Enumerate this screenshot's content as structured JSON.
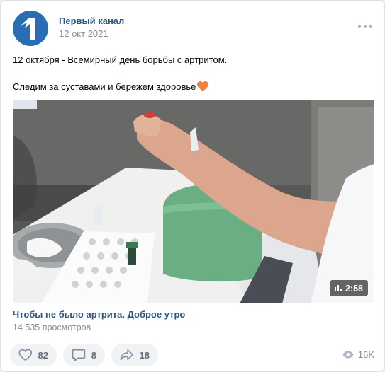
{
  "post": {
    "author": "Первый канал",
    "date": "12 окт 2021",
    "text_line1": "12 октября - Всемирный день борьбы с артритом.",
    "text_line2": "Следим за суставами и бережем здоровье",
    "emoji_icon": "orange-heart-icon"
  },
  "video": {
    "duration": "2:58",
    "title": "Чтобы не было артрита. Доброе утро",
    "views": "14 535 просмотров"
  },
  "actions": {
    "likes": "82",
    "comments": "8",
    "shares": "18",
    "views": "16K"
  },
  "colors": {
    "link": "#2a5885",
    "secondary": "#818c99",
    "avatar": "#2a6db5",
    "heart": "#f5803e"
  }
}
